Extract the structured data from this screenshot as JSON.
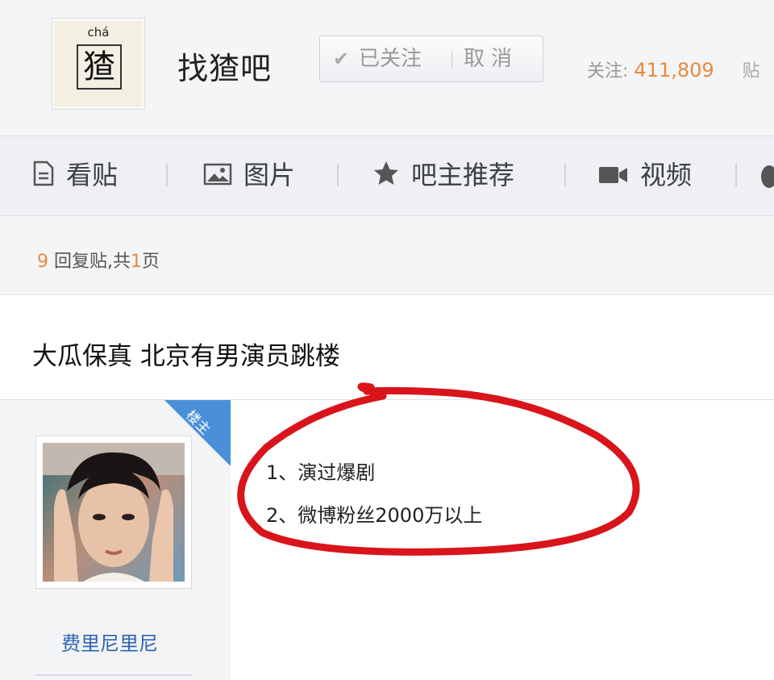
{
  "header": {
    "logo_pinyin": "chá",
    "logo_char": "猹",
    "bar_name": "找猹吧",
    "follow_label": "已关注",
    "cancel_label": "取消",
    "follow_count_label": "关注:",
    "follow_count": "411,809",
    "posts_label_cut": "贴"
  },
  "nav": {
    "items": [
      {
        "label": "看贴",
        "icon": "document-icon"
      },
      {
        "label": "图片",
        "icon": "image-icon"
      },
      {
        "label": "吧主推荐",
        "icon": "star-icon"
      },
      {
        "label": "视频",
        "icon": "video-icon"
      }
    ]
  },
  "thread": {
    "reply_count": "9",
    "reply_text": "回复贴,共",
    "page_count": "1",
    "page_text": "页",
    "title": "大瓜保真 北京有男演员跳楼"
  },
  "post": {
    "badge": "楼主",
    "author": "费里尼里尼",
    "lines": [
      "1、演过爆剧",
      "2、微博粉丝2000万以上"
    ]
  },
  "colors": {
    "accent_orange": "#e8893c",
    "link_blue": "#2d64b3",
    "badge_blue": "#4a90d9",
    "annotation_red": "#d9141b"
  }
}
